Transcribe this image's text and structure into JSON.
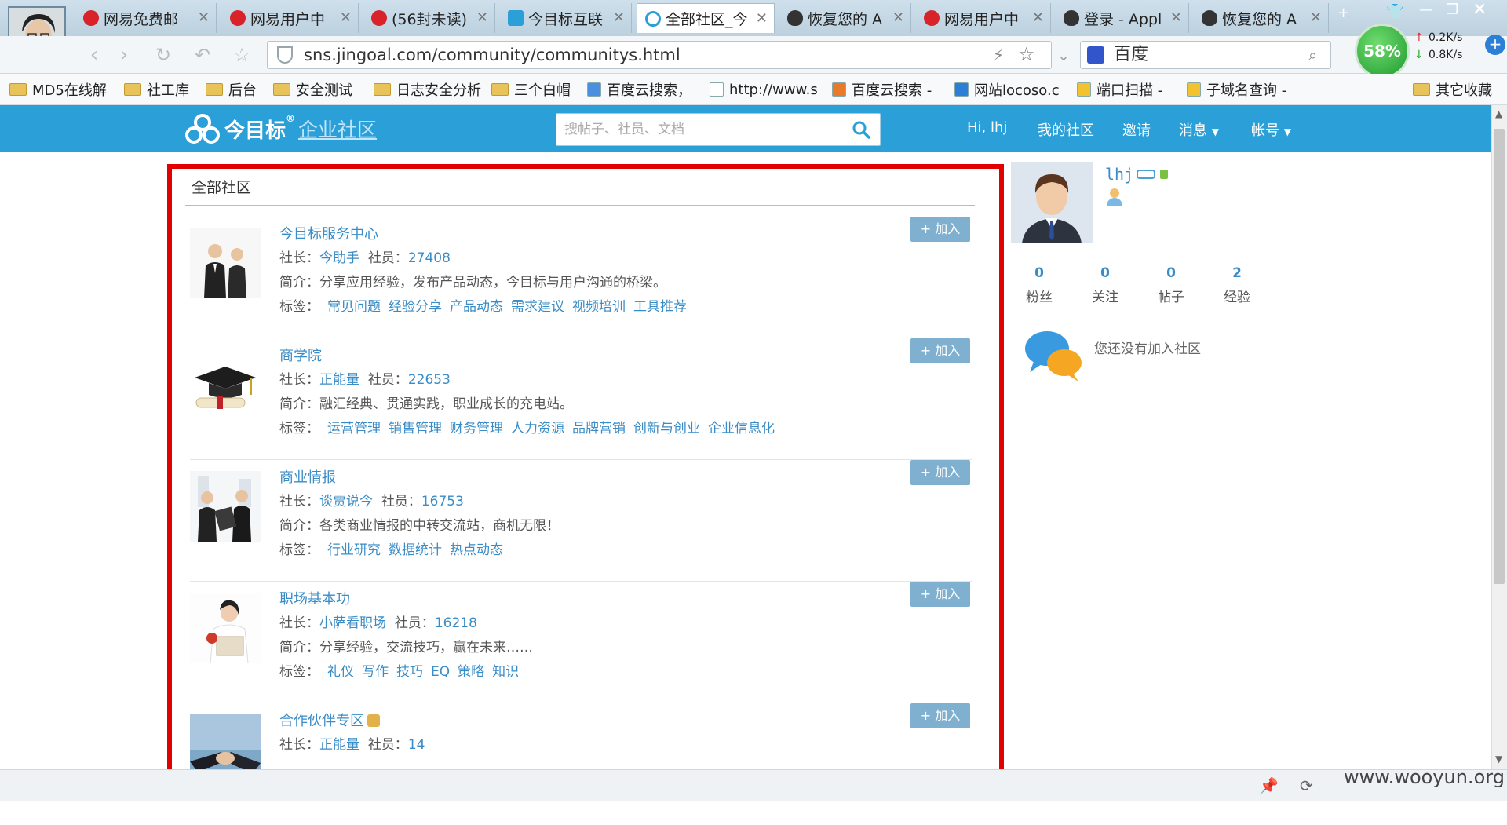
{
  "browser": {
    "tabs": [
      {
        "label": "网易免费邮",
        "icon": "netease-icon"
      },
      {
        "label": "网易用户中",
        "icon": "netease-icon"
      },
      {
        "label": "(56封未读)",
        "icon": "netease-icon"
      },
      {
        "label": "今目标互联",
        "icon": "jingoal-icon"
      },
      {
        "label": "全部社区_今",
        "icon": "jingoal-community-icon"
      },
      {
        "label": "恢复您的 A",
        "icon": "apple-icon"
      },
      {
        "label": "网易用户中",
        "icon": "netease-icon"
      },
      {
        "label": "登录 - Appl",
        "icon": "apple-icon"
      },
      {
        "label": "恢复您的 A",
        "icon": "apple-icon"
      }
    ],
    "url": "sns.jingoal.com/community/communitys.html",
    "search_engine": "百度",
    "speed_meter": {
      "percent": "58%",
      "up": "0.2K/s",
      "down": "0.8K/s"
    },
    "bookmarks": [
      {
        "label": "MD5在线解",
        "icon": "folder-icon"
      },
      {
        "label": "社工库",
        "icon": "folder-icon"
      },
      {
        "label": "后台",
        "icon": "folder-icon"
      },
      {
        "label": "安全测试",
        "icon": "folder-icon"
      },
      {
        "label": "日志安全分析",
        "icon": "folder-icon"
      },
      {
        "label": "三个白帽",
        "icon": "folder-icon"
      },
      {
        "label": "百度云搜索，",
        "icon": "baidu-cloud-icon"
      },
      {
        "label": "http://www.s",
        "icon": "page-icon"
      },
      {
        "label": "百度云搜索 -",
        "icon": "puzzle-icon"
      },
      {
        "label": "网站locoso.c",
        "icon": "locoso-icon"
      },
      {
        "label": "端口扫描 -",
        "icon": "scan-icon"
      },
      {
        "label": "子域名查询 -",
        "icon": "scan-icon"
      },
      {
        "label": "其它收藏",
        "icon": "folder-icon"
      }
    ]
  },
  "site": {
    "logo_text": "今目标",
    "logo_sub": "企业社区",
    "search_placeholder": "搜帖子、社员、文档",
    "nav": [
      "Hi, lhj",
      "我的社区",
      "邀请",
      "消息",
      "帐号"
    ]
  },
  "main": {
    "title": "全部社区",
    "labels": {
      "leader": "社长：",
      "members": "社员：",
      "intro": "简介：",
      "tags": "标签："
    },
    "join_label": "+ 加入",
    "communities": [
      {
        "name": "今目标服务中心",
        "leader": "今助手",
        "members": "27408",
        "intro": "分享应用经验，发布产品动态，今目标与用户沟通的桥梁。",
        "tags": [
          "常见问题",
          "经验分享",
          "产品动态",
          "需求建议",
          "视频培训",
          "工具推荐"
        ]
      },
      {
        "name": "商学院",
        "leader": "正能量",
        "members": "22653",
        "intro": "融汇经典、贯通实践，职业成长的充电站。",
        "tags": [
          "运营管理",
          "销售管理",
          "财务管理",
          "人力资源",
          "品牌营销",
          "创新与创业",
          "企业信息化"
        ]
      },
      {
        "name": "商业情报",
        "leader": "谈贾说今",
        "members": "16753",
        "intro": "各类商业情报的中转交流站，商机无限！",
        "tags": [
          "行业研究",
          "数据统计",
          "热点动态"
        ]
      },
      {
        "name": "职场基本功",
        "leader": "小萨看职场",
        "members": "16218",
        "intro": "分享经验，交流技巧，赢在未来……",
        "tags": [
          "礼仪",
          "写作",
          "技巧",
          "EQ",
          "策略",
          "知识"
        ]
      },
      {
        "name": "合作伙伴专区",
        "leader": "正能量",
        "members": "14"
      }
    ]
  },
  "profile": {
    "username": "lhj",
    "stats": [
      {
        "value": "0",
        "label": "粉丝"
      },
      {
        "value": "0",
        "label": "关注"
      },
      {
        "value": "0",
        "label": "帖子"
      },
      {
        "value": "2",
        "label": "经验"
      }
    ],
    "no_community_text": "您还没有加入社区"
  },
  "watermark": "www.wooyun.org",
  "colors": {
    "header": "#2a9fd8",
    "link": "#3a8cc6",
    "highlight_border": "#e00000",
    "join_button": "#7fb0d0"
  }
}
